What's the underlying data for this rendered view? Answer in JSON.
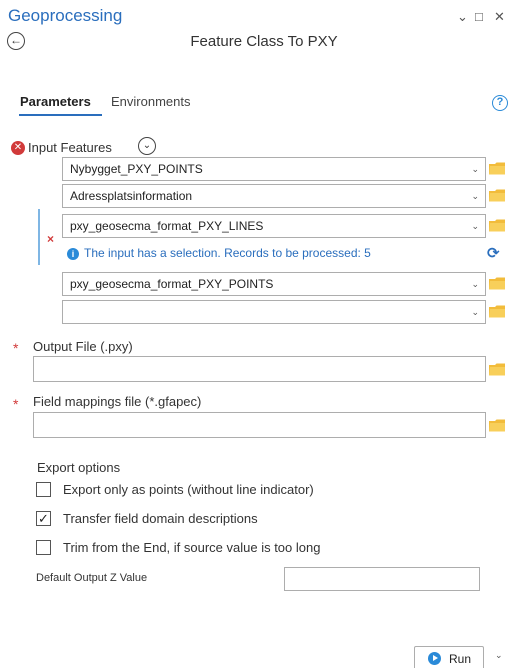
{
  "pane": {
    "title": "Geoprocessing",
    "controls": {
      "menu": "⌄",
      "maximize": "□",
      "close": "✕"
    }
  },
  "tool": {
    "back_icon": "back-arrow-icon",
    "title": "Feature Class To PXY"
  },
  "tabs": [
    {
      "label": "Parameters",
      "active": true
    },
    {
      "label": "Environments",
      "active": false
    }
  ],
  "help_glyph": "?",
  "input_features": {
    "label": "Input Features",
    "rows": [
      {
        "value": "Nybygget_PXY_POINTS"
      },
      {
        "value": "Adressplatsinformation"
      },
      {
        "value": "pxy_geosecma_format_PXY_LINES"
      },
      {
        "value": "pxy_geosecma_format_PXY_POINTS"
      },
      {
        "value": ""
      }
    ],
    "selection_message": "The input has a selection. Records to be processed: 5"
  },
  "output_file": {
    "label": "Output File (.pxy)",
    "value": ""
  },
  "field_mappings": {
    "label": "Field mappings file (*.gfapec)",
    "value": ""
  },
  "export_options": {
    "section_label": "Export options",
    "options": [
      {
        "label": "Export only as points (without line indicator)",
        "checked": false
      },
      {
        "label": "Transfer field domain descriptions",
        "checked": true
      },
      {
        "label": "Trim from the End, if source value is too long",
        "checked": false
      }
    ],
    "default_z_label": "Default Output Z Value",
    "default_z_value": ""
  },
  "run": {
    "label": "Run"
  },
  "colors": {
    "accent": "#2a6ebd",
    "error": "#d13a3a",
    "folder": "#f2bc3b"
  }
}
